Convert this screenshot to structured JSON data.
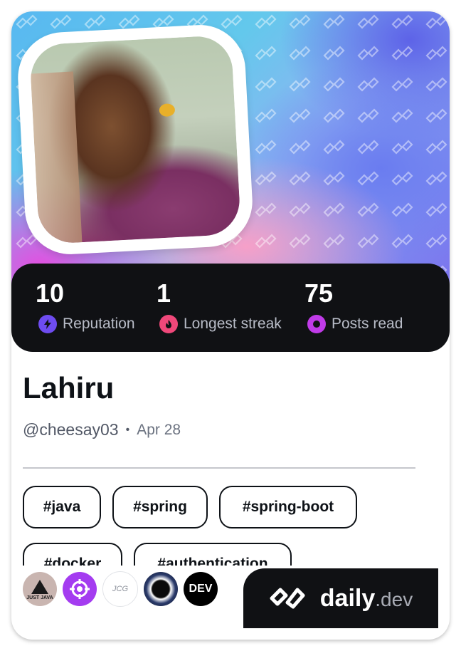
{
  "stats": [
    {
      "value": "10",
      "label": "Reputation",
      "icon": "lightning-icon",
      "color": "#6e4cf0"
    },
    {
      "value": "1",
      "label": "Longest streak",
      "icon": "flame-icon",
      "color": "#f0487a"
    },
    {
      "value": "75",
      "label": "Posts read",
      "icon": "eye-ring-icon",
      "color": "#c03be8"
    }
  ],
  "profile": {
    "name": "Lahiru",
    "handle": "@cheesay03",
    "separator": "•",
    "date": "Apr 28"
  },
  "tags": [
    "#java",
    "#spring",
    "#spring-boot",
    "#docker",
    "#authentication"
  ],
  "badges": [
    {
      "name": "just-java-badge",
      "text": "JUST JAVA"
    },
    {
      "name": "crosshair-badge",
      "text": ""
    },
    {
      "name": "jcg-badge",
      "text": "JCG"
    },
    {
      "name": "eclipse-badge",
      "text": ""
    },
    {
      "name": "dev-badge",
      "text": "DEV"
    }
  ],
  "brand": {
    "name": "daily",
    "suffix": ".dev"
  },
  "colors": {
    "dark": "#101114",
    "accent": "#6e4cf0"
  }
}
